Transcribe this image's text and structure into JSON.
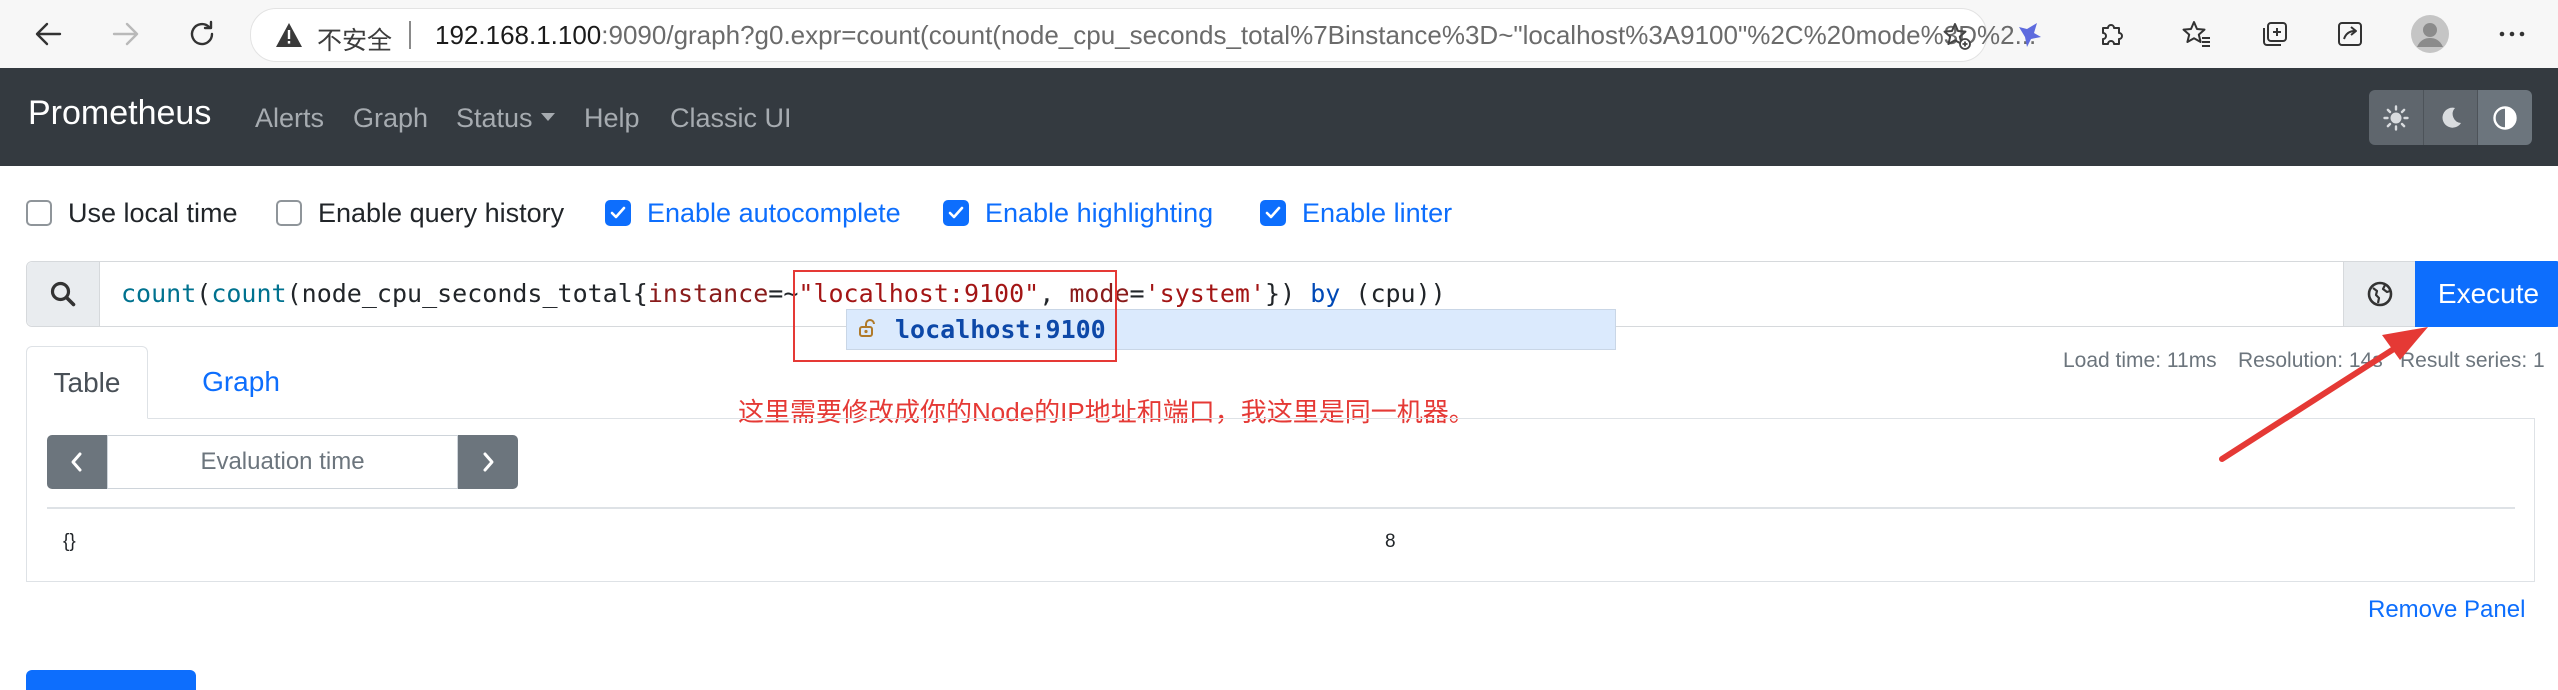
{
  "browser": {
    "security_label": "不安全",
    "url_host": "192.168.1.100",
    "url_rest": ":9090/graph?g0.expr=count(count(node_cpu_seconds_total%7Binstance%3D~\"localhost%3A9100\"%2C%20mode%3D%2...",
    "icons": [
      "back-icon",
      "forward-icon",
      "reload-icon",
      "warning-icon",
      "favorite-add-icon",
      "extension-icon",
      "puzzle-icon",
      "favorites-icon",
      "collections-icon",
      "share-icon",
      "profile-icon",
      "more-icon"
    ]
  },
  "nav": {
    "brand": "Prometheus",
    "links": {
      "alerts": "Alerts",
      "graph": "Graph",
      "status": "Status",
      "help": "Help",
      "classic": "Classic UI"
    },
    "theme_icons": [
      "sun-icon",
      "moon-icon",
      "contrast-icon"
    ]
  },
  "options": {
    "local_time": {
      "label": "Use local time",
      "checked": false
    },
    "query_history": {
      "label": "Enable query history",
      "checked": false
    },
    "autocomplete": {
      "label": "Enable autocomplete",
      "checked": true
    },
    "highlighting": {
      "label": "Enable highlighting",
      "checked": true
    },
    "linter": {
      "label": "Enable linter",
      "checked": true
    }
  },
  "query": {
    "tokens": {
      "t1": "count",
      "t2": "(",
      "t3": "count",
      "t4": "(",
      "t5": "node_cpu_seconds_total",
      "t6": "{",
      "t7": "instance",
      "t8": "=~",
      "t9": "\"localhost:9100\"",
      "t10": ", ",
      "t11": "mode",
      "t12": "=",
      "t13": "'system'",
      "t14": "}",
      "t15": ")",
      "t16": " ",
      "t17": "by",
      "t18": " ",
      "t19": "(cpu)",
      "t20": ")"
    },
    "execute_label": "Execute",
    "autocomplete_suggestion": "localhost:9100"
  },
  "annotation": {
    "text": "这里需要修改成你的Node的IP地址和端口，我这里是同一机器。",
    "color": "#e53935"
  },
  "stats": {
    "load_time": "Load time: 11ms",
    "resolution": "Resolution: 14s",
    "result_series": "Result series: 1"
  },
  "tabs": {
    "table": "Table",
    "graph": "Graph"
  },
  "eval_time_placeholder": "Evaluation time",
  "result": {
    "labels": "{}",
    "value": "8"
  },
  "remove_panel": "Remove Panel",
  "colors": {
    "accent": "#0d6efd",
    "navbar": "#343a40",
    "annotation": "#e53935"
  }
}
